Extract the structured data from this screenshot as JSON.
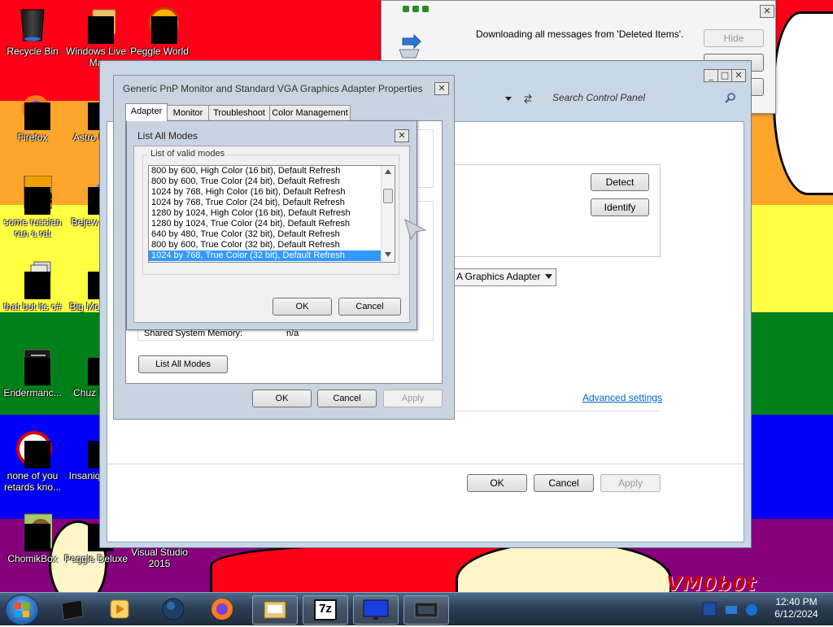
{
  "desktop": {
    "watermark": "VM0b0t",
    "icons": [
      {
        "label": "Recycle Bin"
      },
      {
        "label": "Windows Live Ma"
      },
      {
        "label": "Peggle World"
      },
      {
        "label": "Firefox"
      },
      {
        "label": "Astro Delu"
      },
      {
        "label": "some russian ran a rat"
      },
      {
        "label": "Bejew Delu"
      },
      {
        "label": "that but its c#"
      },
      {
        "label": "Big Mo Delu"
      },
      {
        "label": "Endermanc..."
      },
      {
        "label": "Chuz Delu"
      },
      {
        "label": "none of you retards kno..."
      },
      {
        "label": "Insaniq Delu"
      },
      {
        "label": "ChomikBox"
      },
      {
        "label": "Peggle Deluxe"
      },
      {
        "label": "Visual Studio 2015"
      }
    ]
  },
  "notification": {
    "message": "Downloading all messages from 'Deleted Items'.",
    "hide_label": "Hide",
    "close_glyph": "✕"
  },
  "control_panel": {
    "search_placeholder": "Search Control Panel",
    "detect_label": "Detect",
    "identify_label": "Identify",
    "adapter_dropdown": "A Graphics Adapter",
    "advanced_link": "Advanced settings",
    "ok_label": "OK",
    "cancel_label": "Cancel",
    "apply_label": "Apply"
  },
  "properties": {
    "title": "Generic PnP Monitor and Standard VGA Graphics Adapter Properties",
    "tabs": [
      {
        "label": "Adapter"
      },
      {
        "label": "Monitor"
      },
      {
        "label": "Troubleshoot"
      },
      {
        "label": "Color Management"
      }
    ],
    "shared_memory_label": "Shared System Memory:",
    "shared_memory_value": "n/a",
    "list_all_modes_label": "List All Modes",
    "ok_label": "OK",
    "cancel_label": "Cancel",
    "apply_label": "Apply"
  },
  "modes_dialog": {
    "title": "List All Modes",
    "legend": "List of valid modes",
    "modes": [
      "800 by 600, High Color (16 bit), Default Refresh",
      "800 by 600, True Color (24 bit), Default Refresh",
      "1024 by 768, High Color (16 bit), Default Refresh",
      "1024 by 768, True Color (24 bit), Default Refresh",
      "1280 by 1024, High Color (16 bit), Default Refresh",
      "1280 by 1024, True Color (24 bit), Default Refresh",
      "640 by 480, True Color (32 bit), Default Refresh",
      "800 by 600, True Color (32 bit), Default Refresh",
      "1024 by 768, True Color (32 bit), Default Refresh"
    ],
    "ok_label": "OK",
    "cancel_label": "Cancel"
  },
  "taskbar": {
    "time": "12:40 PM",
    "date": "6/12/2024",
    "items": [
      "media-player",
      "media-player-classic",
      "globe",
      "firefox",
      "outlook",
      "7-zip",
      "display-settings",
      "control-panel"
    ],
    "seven_zip_text": "7z"
  },
  "colors": {
    "rainbow": [
      "#ff0018",
      "#ffa52c",
      "#ffff41",
      "#008018",
      "#0000f9",
      "#86007d"
    ],
    "selection": "#3399ff",
    "link": "#0066cc"
  }
}
